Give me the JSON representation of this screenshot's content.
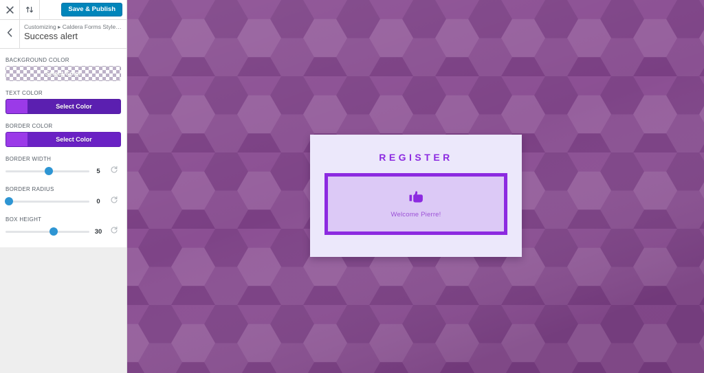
{
  "customizer": {
    "topbar": {
      "close_icon": "close-icon",
      "close_label": "Close",
      "collapse_icon": "expand-collapse-icon",
      "collapse_label": "Collapse",
      "publish_label": "Save & Publish"
    },
    "header": {
      "back_icon": "chevron-left-icon",
      "breadcrumb": "Customizing ▸ Caldera Forms Style C...",
      "section_title": "Success alert"
    },
    "controls": [
      {
        "type": "color",
        "name": "background-color",
        "label": "BACKGROUND COLOR",
        "button_label": "Select Color",
        "value": "transparent",
        "transparent": true
      },
      {
        "type": "color",
        "name": "text-color",
        "label": "TEXT COLOR",
        "button_label": "Select Color",
        "value": "#9b3ae8",
        "button_bg": "#5b1fb0",
        "transparent": false
      },
      {
        "type": "color",
        "name": "border-color",
        "label": "BORDER COLOR",
        "button_label": "Select Color",
        "value": "#9b3ae8",
        "button_bg": "#6a21c4",
        "transparent": false
      },
      {
        "type": "slider",
        "name": "border-width",
        "label": "BORDER WIDTH",
        "value": "5",
        "percent": 52,
        "reset_icon": "reset-icon"
      },
      {
        "type": "slider",
        "name": "border-radius",
        "label": "BORDER RADIUS",
        "value": "0",
        "percent": 1,
        "reset_icon": "reset-icon"
      },
      {
        "type": "slider",
        "name": "box-height",
        "label": "BOX HEIGHT",
        "value": "30",
        "percent": 57,
        "reset_icon": "reset-icon"
      }
    ]
  },
  "preview": {
    "background_color": "#8b4f93",
    "form": {
      "title": "REGISTER",
      "alert": {
        "icon": "thumbs-up-icon",
        "message": "Welcome Pierre!",
        "background_color": "#dcc9f6",
        "border_color": "#8c2ae0",
        "text_color": "#9b51d6"
      },
      "card_background": "#ece8fb",
      "title_color": "#8c2ae0"
    }
  }
}
